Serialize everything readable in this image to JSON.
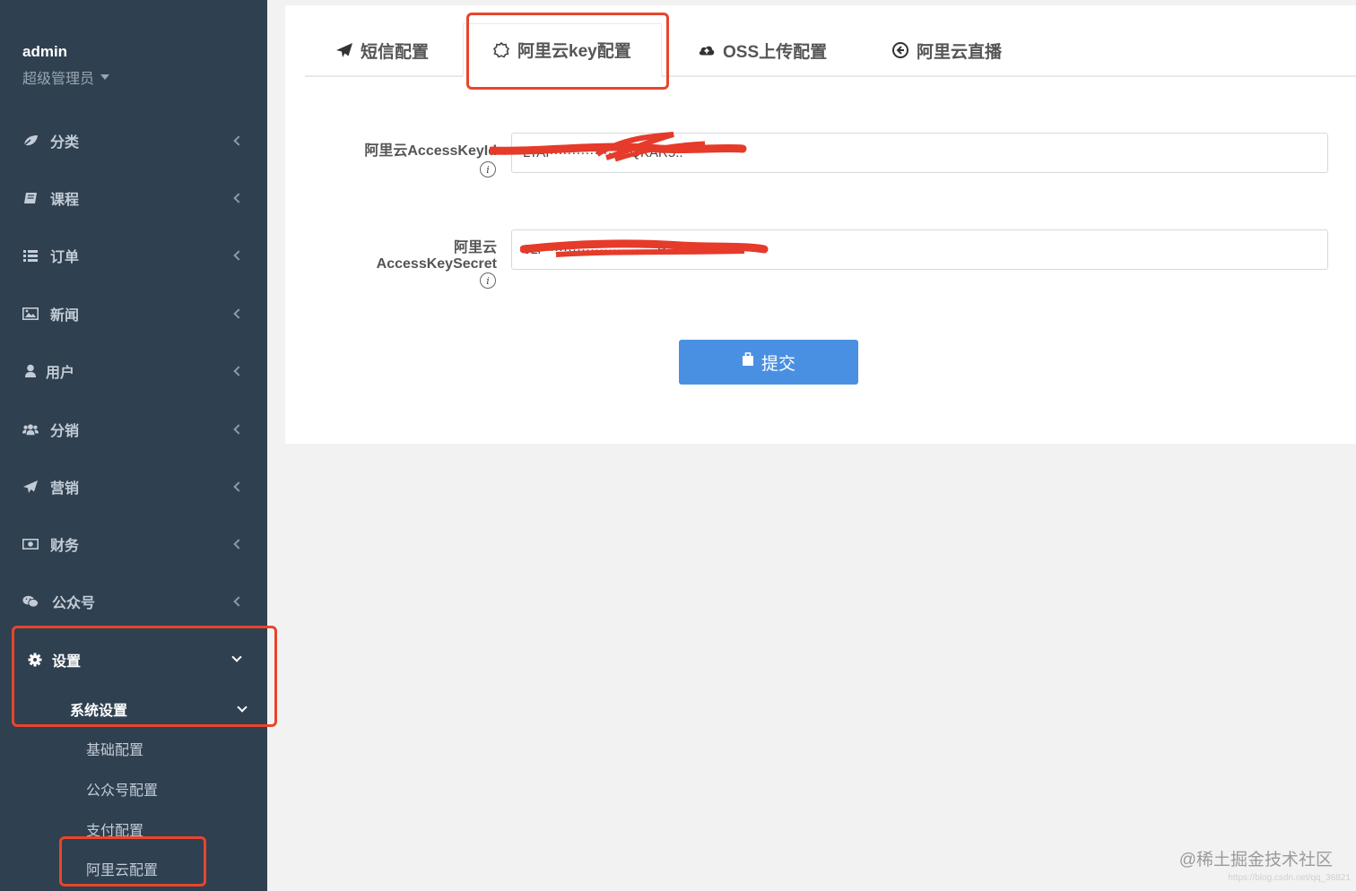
{
  "user": {
    "name": "admin",
    "role": "超级管理员"
  },
  "nav": [
    {
      "label": "分类",
      "icon": "leaf-icon"
    },
    {
      "label": "课程",
      "icon": "book-icon"
    },
    {
      "label": "订单",
      "icon": "list-icon"
    },
    {
      "label": "新闻",
      "icon": "image-icon"
    },
    {
      "label": "用户",
      "icon": "user-icon"
    },
    {
      "label": "分销",
      "icon": "users-icon"
    },
    {
      "label": "营销",
      "icon": "paper-plane-icon"
    },
    {
      "label": "财务",
      "icon": "money-icon"
    },
    {
      "label": "公众号",
      "icon": "wechat-icon"
    },
    {
      "label": "设置",
      "icon": "gear-icon"
    }
  ],
  "submenu": {
    "group": "系统设置",
    "items": [
      "基础配置",
      "公众号配置",
      "支付配置",
      "阿里云配置"
    ]
  },
  "tabs": [
    {
      "label": "短信配置",
      "icon": "paper-plane-icon"
    },
    {
      "label": "阿里云key配置",
      "icon": "gear-outline-icon"
    },
    {
      "label": "OSS上传配置",
      "icon": "cloud-upload-icon"
    },
    {
      "label": "阿里云直播",
      "icon": "circle-arrow-icon"
    }
  ],
  "form": {
    "access_key_id_label": "阿里云AccessKeyId",
    "access_key_id_value": "LTAI··················QKAR5..",
    "access_key_secret_label_line1": "阿里云",
    "access_key_secret_label_line2": "AccessKeySecret",
    "access_key_secret_value": "6Ll··························P",
    "info_glyph": "i",
    "submit_label": "提交"
  },
  "watermark": "@稀土掘金技术社区",
  "watermark_url": "https://blog.csdn.net/qq_36821"
}
